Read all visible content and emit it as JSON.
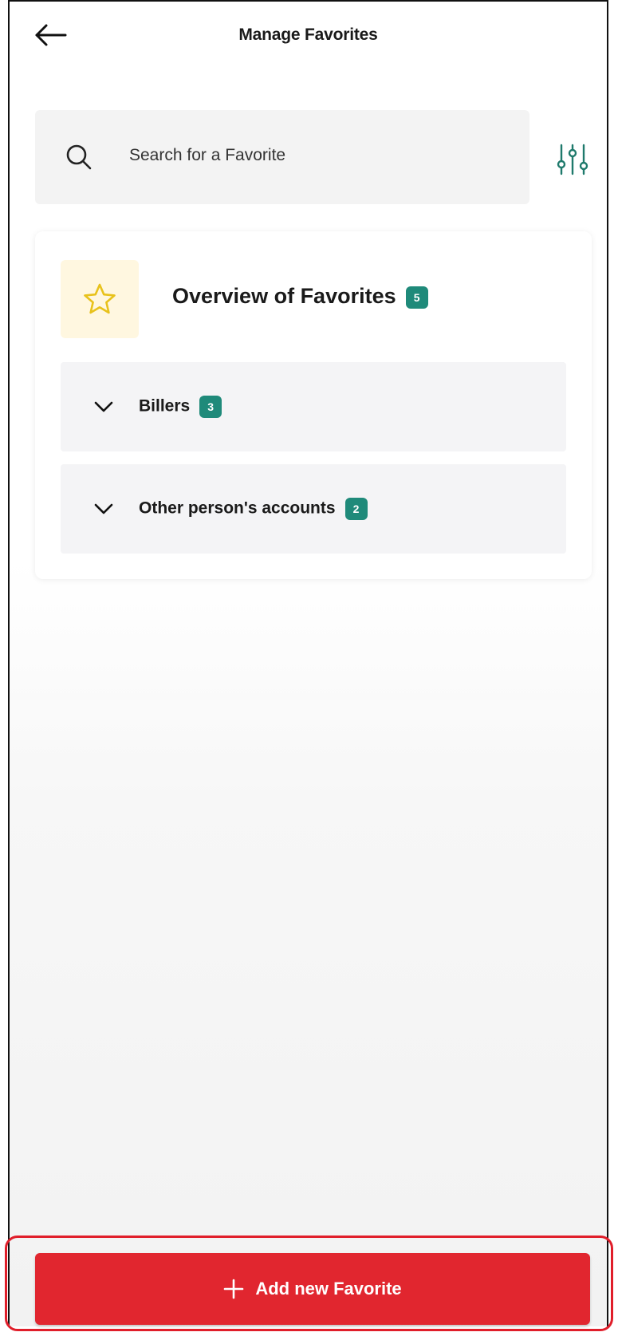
{
  "header": {
    "title": "Manage Favorites",
    "back_icon": "back-arrow-icon"
  },
  "search": {
    "placeholder": "Search for a Favorite",
    "icon": "search-icon",
    "filter_icon": "filter-sliders-icon"
  },
  "overview": {
    "title": "Overview of Favorites",
    "count": "5",
    "icon": "star-icon"
  },
  "sections": [
    {
      "label": "Billers",
      "count": "3"
    },
    {
      "label": "Other person's accounts",
      "count": "2"
    }
  ],
  "add_button": {
    "label": "Add new Favorite",
    "icon": "plus-icon"
  },
  "colors": {
    "accent_red": "#e1262f",
    "badge_teal": "#1f8a7a",
    "star_yellow": "#e8c21c"
  }
}
